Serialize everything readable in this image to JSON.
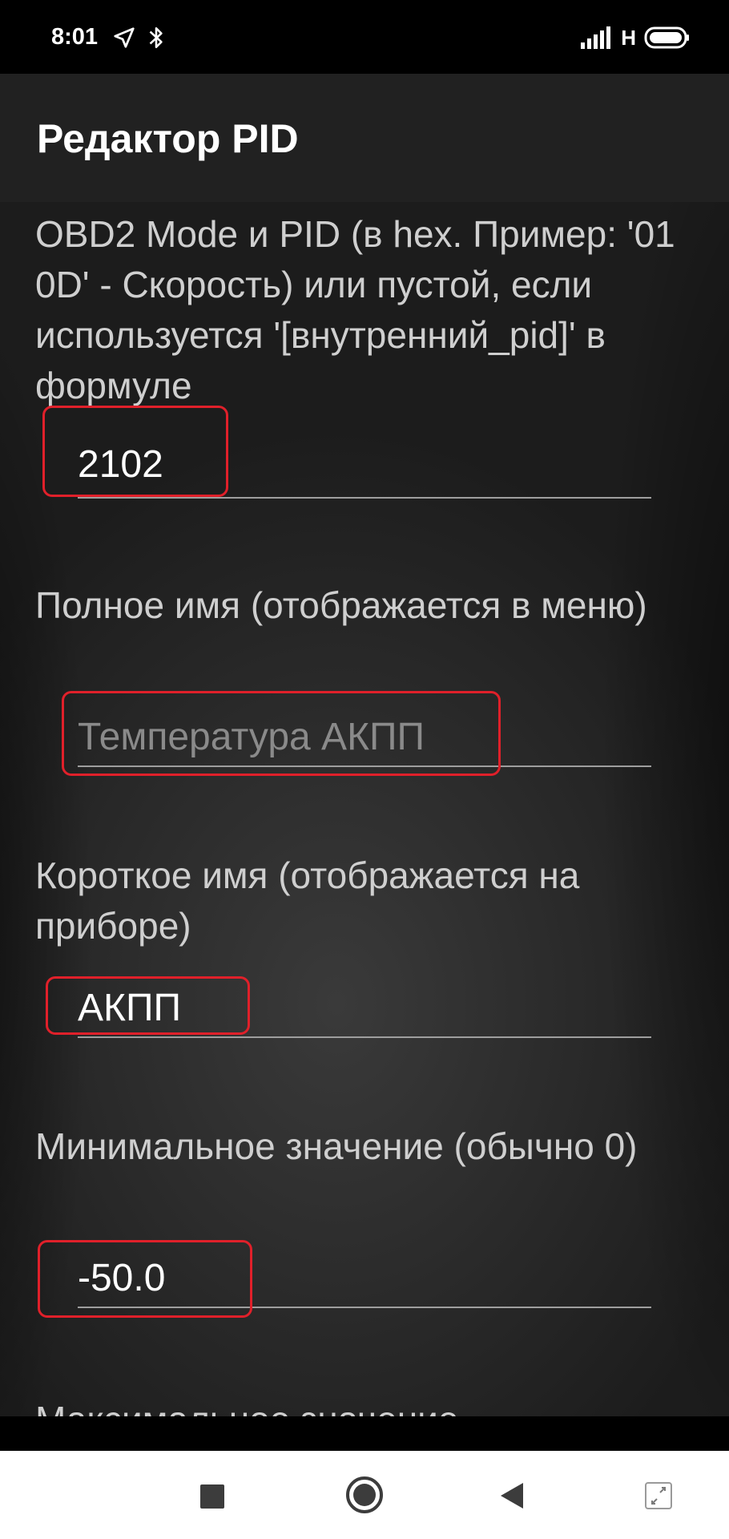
{
  "status_bar": {
    "time": "8:01",
    "network_label": "H",
    "icons": [
      "location-arrow-icon",
      "bluetooth-icon",
      "signal-icon",
      "battery-icon"
    ]
  },
  "app_bar": {
    "title": "Редактор PID"
  },
  "fields": [
    {
      "label": "OBD2 Mode и PID (в hex. Пример: '01 0D' - Скорость) или пустой, если используется '[внутренний_pid]' в формуле",
      "value": "2102"
    },
    {
      "label": "Полное имя (отображается в меню)",
      "placeholder": "Температура АКПП"
    },
    {
      "label": "Короткое имя (отображается на приборе)",
      "value": "АКПП"
    },
    {
      "label": "Минимальное значение (обычно 0)",
      "value": "-50.0"
    },
    {
      "label": "Максимальное значение"
    }
  ],
  "nav_bar": {
    "buttons": [
      "recents-button",
      "home-button",
      "back-button",
      "screen-rotate-button"
    ]
  },
  "colors": {
    "highlight": "#e0202a",
    "app_bar": "#212121",
    "label": "#cfcfcf"
  }
}
